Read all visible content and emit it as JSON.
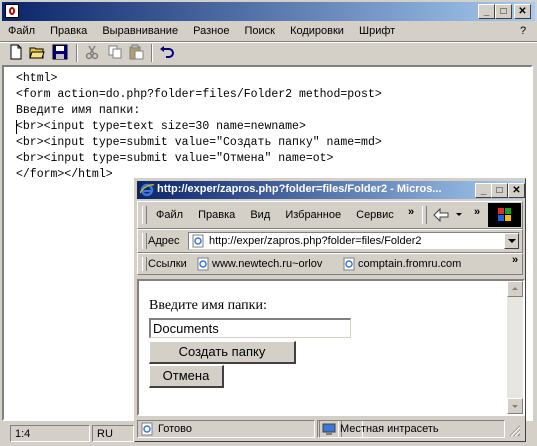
{
  "editor_window": {
    "title": "",
    "caption_buttons": {
      "minimize": "_",
      "maximize": "□",
      "close": "✕"
    },
    "menu": [
      "Файл",
      "Правка",
      "Выравнивание",
      "Разное",
      "Поиск",
      "Кодировки",
      "Шрифт"
    ],
    "help_label": "?",
    "toolbar_icons": [
      "new-file-icon",
      "open-folder-icon",
      "save-icon",
      "cut-icon",
      "copy-icon",
      "paste-icon",
      "undo-icon"
    ],
    "lines": [
      "<html>",
      "<form action=do.php?folder=files/Folder2 method=post>",
      "Введите имя папки:",
      "<br><input type=text size=30 name=newname>",
      "<br><input type=submit value=\"Создать папку\" name=md>",
      "<br><input type=submit value=\"Отмена\" name=ot>",
      "</form></html>"
    ],
    "status": {
      "position": "1:4",
      "language": "RU"
    }
  },
  "browser_window": {
    "title": "http://exper/zapros.php?folder=files/Folder2 - Micros...",
    "menu": [
      "Файл",
      "Правка",
      "Вид",
      "Избранное",
      "Сервис"
    ],
    "menu_more": "»",
    "address_label": "Адрес",
    "address_value": "http://exper/zapros.php?folder=files/Folder2",
    "links_label": "Ссылки",
    "links": [
      "www.newtech.ru~orlov",
      "comptain.fromru.com"
    ],
    "links_more": "»",
    "page": {
      "prompt": "Введите имя папки:",
      "input_value": "Documents",
      "create_button": "Создать папку",
      "cancel_button": "Отмена"
    },
    "status": {
      "text": "Готово",
      "zone": "Местная интрасеть"
    }
  }
}
